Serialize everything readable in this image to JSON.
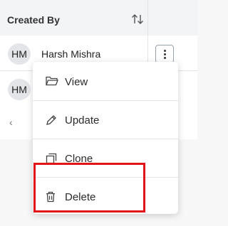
{
  "table": {
    "header": {
      "created_by_label": "Created By"
    },
    "rows": [
      {
        "initials": "HM",
        "name": "Harsh Mishra"
      },
      {
        "initials": "HM",
        "name": ""
      }
    ],
    "pager": {
      "prev": "‹"
    }
  },
  "menu": {
    "items": [
      {
        "label": "View",
        "icon": "folder-icon"
      },
      {
        "label": "Update",
        "icon": "pencil-icon"
      },
      {
        "label": "Clone",
        "icon": "clone-icon"
      },
      {
        "label": "Delete",
        "icon": "trash-icon"
      }
    ]
  },
  "colors": {
    "highlight": "#e0151a",
    "header_bg": "#f3f4f6"
  }
}
